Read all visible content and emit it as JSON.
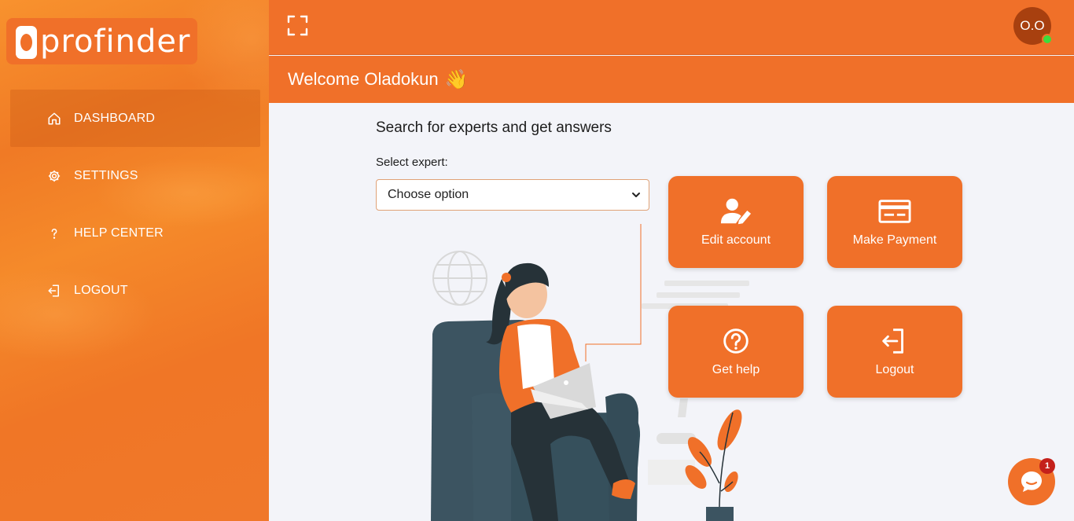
{
  "brand": {
    "name": "profinder",
    "accent": "#f07029"
  },
  "sidebar": {
    "items": [
      {
        "label": "DASHBOARD",
        "icon": "home-icon",
        "active": true
      },
      {
        "label": "SETTINGS",
        "icon": "gear-icon",
        "active": false
      },
      {
        "label": "HELP CENTER",
        "icon": "question-icon",
        "active": false
      },
      {
        "label": "LOGOUT",
        "icon": "logout-icon",
        "active": false
      }
    ]
  },
  "header": {
    "expand_icon": "fullscreen-icon",
    "avatar_initials": "O.O",
    "online_status_color": "#3ddc3d"
  },
  "welcome": {
    "text": "Welcome Oladokun",
    "emoji": "👋"
  },
  "main": {
    "search_title": "Search for experts and get answers",
    "select_label": "Select expert:",
    "select_value": "Choose option",
    "tiles": [
      {
        "label": "Edit account",
        "icon": "user-edit-icon"
      },
      {
        "label": "Make Payment",
        "icon": "credit-card-icon"
      },
      {
        "label": "Get help",
        "icon": "question-circle-icon"
      },
      {
        "label": "Logout",
        "icon": "logout-icon"
      }
    ]
  },
  "chat": {
    "badge_count": "1",
    "icon": "chat-icon"
  }
}
